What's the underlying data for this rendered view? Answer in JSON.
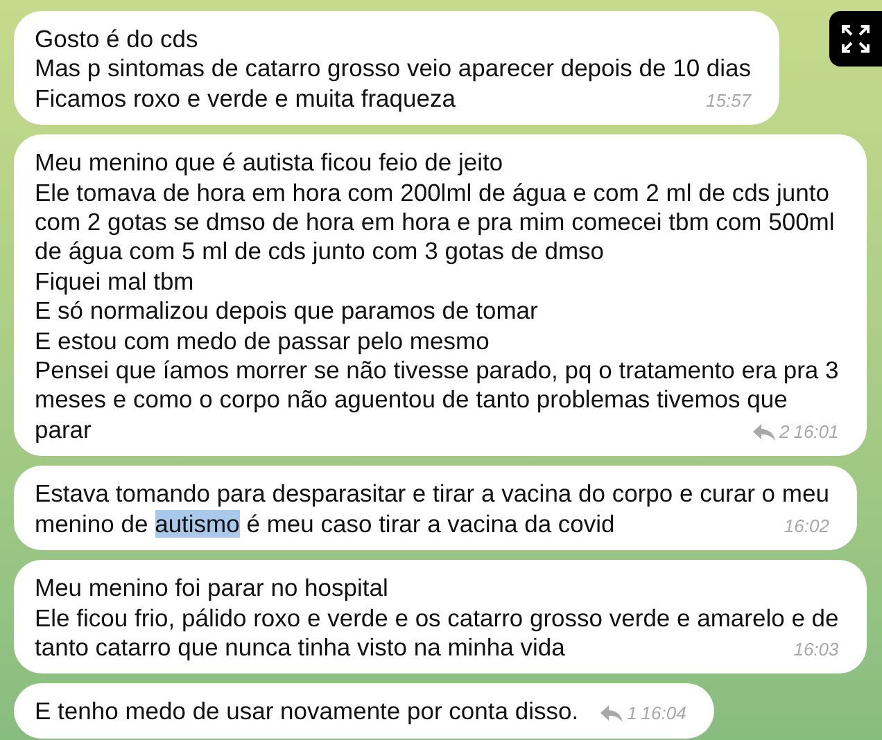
{
  "messages": [
    {
      "lines": [
        "Gosto é do cds",
        "Mas p sintomas de catarro grosso veio aparecer depois de 10 dias",
        "Ficamos roxo e verde e muita fraqueza"
      ],
      "time": "15:57"
    },
    {
      "lines": [
        "Meu menino que é autista ficou feio de jeito",
        "Ele tomava de hora em hora com 200lml de água e com 2 ml de cds junto",
        "com 2 gotas se dmso de hora em hora e pra mim comecei tbm com 500ml",
        "de água com 5 ml de cds junto com 3 gotas de dmso",
        "Fiquei mal tbm",
        "E só normalizou depois que paramos de tomar",
        "E estou com medo de passar pelo mesmo",
        "Pensei que íamos morrer se não tivesse parado, pq o tratamento era pra 3",
        "meses e como o corpo não aguentou de tanto problemas tivemos que",
        "parar"
      ],
      "replies": "2",
      "time": "16:01"
    },
    {
      "lines": [
        "Estava tomando para desparasitar e tirar a vacina do corpo e curar o meu",
        {
          "segments": [
            {
              "text": "menino de ",
              "highlighted": false
            },
            {
              "text": "autismo",
              "highlighted": true
            },
            {
              "text": " é meu caso tirar a vacina da covid",
              "highlighted": false
            }
          ]
        }
      ],
      "time": "16:02"
    },
    {
      "lines": [
        "Meu menino foi parar no hospital",
        "Ele ficou frio, pálido roxo e verde e os catarro grosso verde e amarelo e de",
        "tanto catarro que nunca tinha visto na minha vida"
      ],
      "time": "16:03"
    },
    {
      "lines": [
        "E tenho medo de usar novamente por conta disso."
      ],
      "replies": "1",
      "time": "16:04"
    }
  ]
}
